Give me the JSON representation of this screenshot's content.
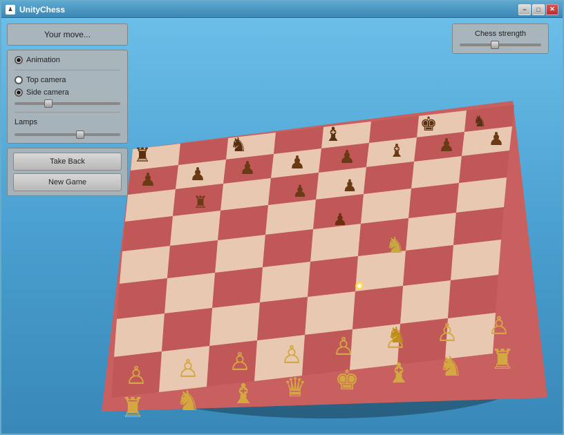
{
  "window": {
    "title": "UnityChess",
    "icon": "♟"
  },
  "titlebar": {
    "minimize_label": "−",
    "maximize_label": "□",
    "close_label": "✕"
  },
  "left_panel": {
    "your_move": "Your move...",
    "animation_label": "Animation",
    "top_camera_label": "Top camera",
    "side_camera_label": "Side camera",
    "lamps_label": "Lamps",
    "take_back_label": "Take Back",
    "new_game_label": "New Game"
  },
  "strength_panel": {
    "title": "Chess strength",
    "slider_value": 40
  },
  "sliders": {
    "camera_value": 30,
    "lamps_value": 60
  },
  "board": {
    "colors": {
      "light_square": "#e8c8b0",
      "dark_square": "#c06060",
      "border": "#b85050",
      "bg": "#cc7070"
    }
  }
}
